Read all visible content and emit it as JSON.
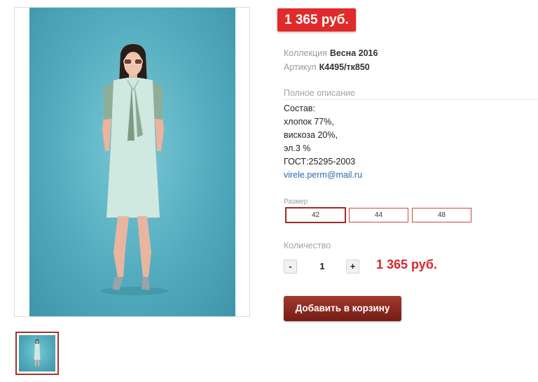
{
  "price_badge": "1 365 руб.",
  "collection": {
    "label": "Коллекция",
    "value": "Весна 2016"
  },
  "sku": {
    "label": "Артикул",
    "value": "К4495/тк850"
  },
  "description": {
    "heading": "Полное описание",
    "lines": [
      "Состав:",
      "хлопок 77%,",
      "вискоза 20%,",
      "эл.3 %",
      "ГОСТ:25295-2003"
    ],
    "email": "virele.perm@mail.ru"
  },
  "size": {
    "label": "Размер",
    "options": [
      "42",
      "44",
      "48"
    ],
    "selected": "42"
  },
  "quantity": {
    "label": "Количество",
    "minus": "-",
    "value": "1",
    "plus": "+"
  },
  "total_price": "1 365 руб.",
  "add_to_cart": "Добавить в корзину",
  "colors": {
    "badge": "#e12a2a",
    "accent": "#a5342a",
    "price_text": "#d8262a",
    "link": "#2a6bb0"
  }
}
